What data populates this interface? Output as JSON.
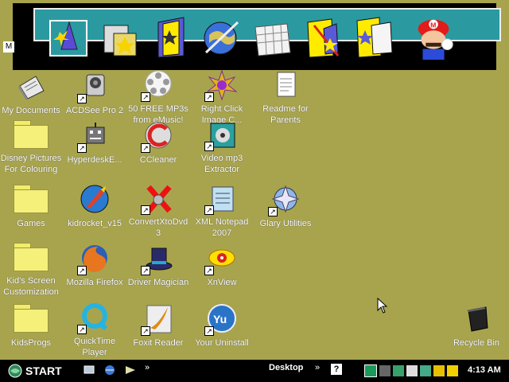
{
  "desktop": {
    "icons": [
      {
        "label": "My Documents"
      },
      {
        "label": "ACDSee Pro 2"
      },
      {
        "label": "50 FREE MP3s from eMusic!"
      },
      {
        "label": "Right Click Image C..."
      },
      {
        "label": "Readme for Parents"
      },
      {
        "label": "Disney Pictures For Colouring"
      },
      {
        "label": "HyperdeskE..."
      },
      {
        "label": "CCleaner"
      },
      {
        "label": "Video mp3 Extractor"
      },
      {
        "label": "Games"
      },
      {
        "label": "kidrocket_v15"
      },
      {
        "label": "ConvertXtoDvd 3"
      },
      {
        "label": "XML Notepad 2007"
      },
      {
        "label": "Glary Utilities"
      },
      {
        "label": "Kid's Screen Customization"
      },
      {
        "label": "Mozilla Firefox"
      },
      {
        "label": "Driver Magician"
      },
      {
        "label": "XnView"
      },
      {
        "label": "KidsProgs"
      },
      {
        "label": "QuickTime Player"
      },
      {
        "label": "Foxit Reader"
      },
      {
        "label": "Your Uninstall"
      },
      {
        "label": "Recycle Bin"
      }
    ]
  },
  "launchbar": {
    "m_label": "M",
    "items": [
      "wizard-hat-icon",
      "stamp-icon",
      "star-folder-icon",
      "globe-icon",
      "calendar-icon",
      "paint-folder-icon",
      "blank-folder-icon",
      "mario-icon"
    ]
  },
  "taskbar": {
    "start_label": "START",
    "quick_chevron": "»",
    "desktop_label": "Desktop",
    "desktop_chevron": "»",
    "help_label": "?",
    "clock": "4:13 AM"
  }
}
